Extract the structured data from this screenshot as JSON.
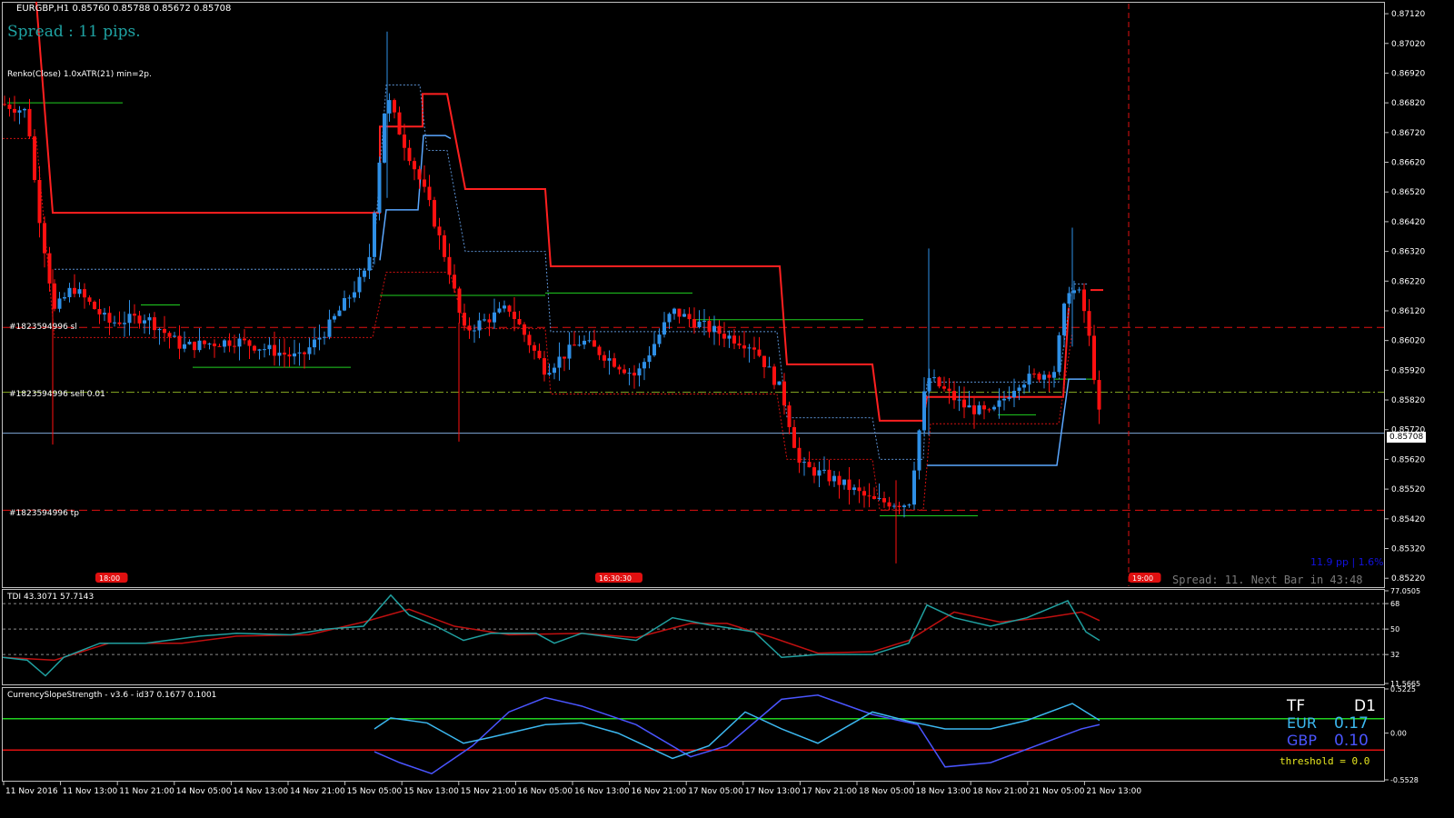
{
  "header": {
    "symbol_line": "EURGBP,H1  0.85760 0.85788 0.85672 0.85708",
    "spread_text": "Spread : 11 pips.",
    "renko_text": "Renko(Close) 1.0xATR(21) min=2p.",
    "current_price": "0.85708"
  },
  "orders": {
    "sl_label": "#1823594996 sl",
    "sell_label": "#1823594996 sell 0.01",
    "tp_label": "#1823594996 tp"
  },
  "time_flags": [
    "18:00",
    "16:30:30",
    "19:00"
  ],
  "bar_info": {
    "range_text": "11.9 pp | 1.6%",
    "spread_next_bar": "Spread: 11. Next Bar in 43:48"
  },
  "price_axis": {
    "ticks": [
      "0.87120",
      "0.87020",
      "0.86920",
      "0.86820",
      "0.86720",
      "0.86620",
      "0.86520",
      "0.86420",
      "0.86320",
      "0.86220",
      "0.86120",
      "0.86020",
      "0.85920",
      "0.85820",
      "0.85720",
      "0.85620",
      "0.85520",
      "0.85420",
      "0.85320",
      "0.85220"
    ],
    "min": 0.8519,
    "max": 0.8716
  },
  "tdi": {
    "label": "TDI 43.3071 57.7143",
    "axis_ticks": [
      "77.0505",
      "68",
      "50",
      "32",
      "11.5665"
    ],
    "levels": [
      68,
      50,
      32
    ],
    "min": 11.5665,
    "max": 77.0505
  },
  "css": {
    "label": "CurrencySlopeStrength - v3.6 - id37 0.1677 0.1001",
    "axis_ticks": [
      "0.5225",
      "0.00",
      "-0.5528"
    ],
    "min": -0.5528,
    "max": 0.5225,
    "table": {
      "tf_label": "TF",
      "tf_value": "D1",
      "rows": [
        {
          "name": "EUR",
          "value": "0.17"
        },
        {
          "name": "GBP",
          "value": "0.10"
        }
      ],
      "threshold": "threshold = 0.0"
    }
  },
  "time_axis": {
    "labels": [
      "11 Nov 2016",
      "11 Nov 13:00",
      "11 Nov 21:00",
      "14 Nov 05:00",
      "14 Nov 13:00",
      "14 Nov 21:00",
      "15 Nov 05:00",
      "15 Nov 13:00",
      "15 Nov 21:00",
      "16 Nov 05:00",
      "16 Nov 13:00",
      "16 Nov 21:00",
      "17 Nov 05:00",
      "17 Nov 13:00",
      "17 Nov 21:00",
      "18 Nov 05:00",
      "18 Nov 13:00",
      "18 Nov 21:00",
      "21 Nov 05:00",
      "21 Nov 13:00"
    ]
  },
  "colors": {
    "bull": "#2e8fe6",
    "bear": "#ff1010",
    "renko_red": "#ff2020",
    "renko_blue": "#5aa7ff",
    "green_level": "#20d020",
    "tdi_teal": "#20a0a0",
    "tdi_red": "#c01010",
    "eur_line": "#3cb8f0",
    "gbp_line": "#4a55ff",
    "spread_text": "#1fa3a3"
  },
  "chart_data": {
    "type": "candlestick",
    "symbol": "EURGBP",
    "timeframe": "H1",
    "last_bar": {
      "open": 0.8576,
      "high": 0.85788,
      "low": 0.85672,
      "close": 0.85708
    },
    "approx_close_path": [
      [
        0,
        0.8682
      ],
      [
        30,
        0.8679
      ],
      [
        40,
        0.865
      ],
      [
        60,
        0.8612
      ],
      [
        80,
        0.862
      ],
      [
        120,
        0.8608
      ],
      [
        160,
        0.861
      ],
      [
        200,
        0.86
      ],
      [
        260,
        0.8602
      ],
      [
        330,
        0.8596
      ],
      [
        360,
        0.8606
      ],
      [
        405,
        0.8626
      ],
      [
        425,
        0.8685
      ],
      [
        440,
        0.8672
      ],
      [
        470,
        0.865
      ],
      [
        495,
        0.8625
      ],
      [
        510,
        0.8605
      ],
      [
        560,
        0.8613
      ],
      [
        600,
        0.8592
      ],
      [
        640,
        0.8602
      ],
      [
        700,
        0.859
      ],
      [
        740,
        0.8612
      ],
      [
        780,
        0.8606
      ],
      [
        830,
        0.86
      ],
      [
        860,
        0.8585
      ],
      [
        880,
        0.856
      ],
      [
        920,
        0.8555
      ],
      [
        960,
        0.8548
      ],
      [
        1000,
        0.8547
      ],
      [
        1020,
        0.859
      ],
      [
        1060,
        0.858
      ],
      [
        1090,
        0.8577
      ],
      [
        1120,
        0.8588
      ],
      [
        1160,
        0.8592
      ],
      [
        1175,
        0.862
      ],
      [
        1190,
        0.8617
      ],
      [
        1200,
        0.86
      ],
      [
        1212,
        0.8571
      ]
    ]
  }
}
